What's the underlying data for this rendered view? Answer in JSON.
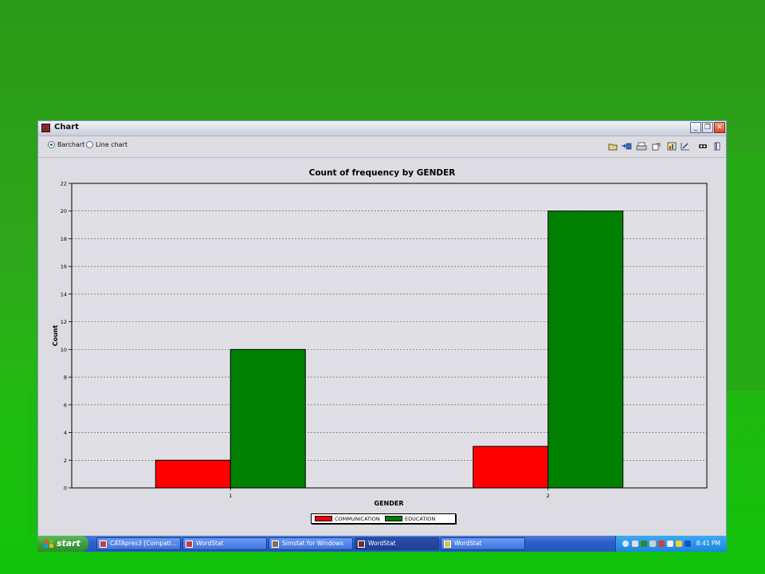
{
  "window": {
    "title": "Chart",
    "buttons": {
      "minimize": "_",
      "maximize": "❐",
      "close": "✕"
    }
  },
  "toolbar": {
    "view_options": [
      {
        "label": "Barchart",
        "selected": true
      },
      {
        "label": "Line chart",
        "selected": false
      }
    ],
    "tool_icons": [
      "open-icon",
      "export-icon",
      "print-icon",
      "copy-icon",
      "chart-settings-icon",
      "edit-icon",
      "3d-icon",
      "exit-icon"
    ]
  },
  "chart_data": {
    "type": "bar",
    "title": "Count of frequency by GENDER",
    "xlabel": "GENDER",
    "ylabel": "Count",
    "categories": [
      "1",
      "2"
    ],
    "ylim": [
      0,
      22
    ],
    "yticks": [
      0,
      2,
      4,
      6,
      8,
      10,
      12,
      14,
      16,
      18,
      20,
      22
    ],
    "grid": true,
    "legend_position": "bottom",
    "series": [
      {
        "name": "COMMUNICATION",
        "values": [
          2,
          3
        ],
        "color": "#ff0000"
      },
      {
        "name": "EDUCATION",
        "values": [
          10,
          20
        ],
        "color": "#008000"
      }
    ]
  },
  "taskbar": {
    "start_label": "start",
    "tasks": [
      {
        "label": "CATApres3 [Compati...",
        "active": false
      },
      {
        "label": "WordStat",
        "active": false
      },
      {
        "label": "Simstat for Windows",
        "active": false
      },
      {
        "label": "WordStat",
        "active": true
      },
      {
        "label": "WordStat",
        "active": false
      }
    ],
    "clock": "8:41 PM"
  }
}
